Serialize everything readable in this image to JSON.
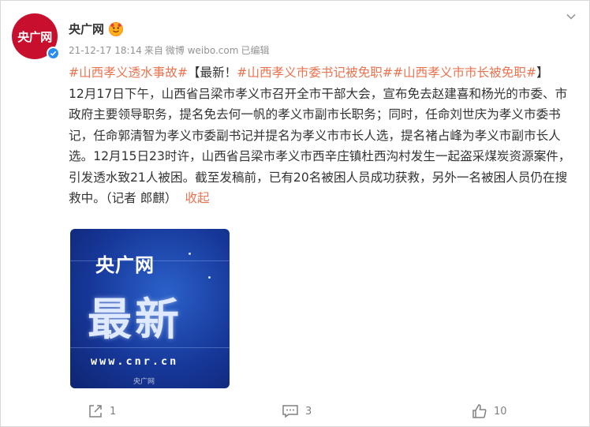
{
  "post": {
    "avatar_logo": "央广网",
    "user_name": "央广网",
    "time": "21-12-17 18:14",
    "source_prefix": "来自",
    "source": "微博 weibo.com",
    "edited": "已编辑",
    "text": {
      "tag1": "#山西孝义透水事故#",
      "bracket_open": "【最新！",
      "tag2": "#山西孝义市委书记被免职#",
      "tag3": "#山西孝义市市长被免职#",
      "bracket_close": "】",
      "body": "12月17日下午，山西省吕梁市孝义市召开全市干部大会，宣布免去赵建喜和杨光的市委、市政府主要领导职务，提名免去何一帆的孝义市副市长职务；同时，任命刘世庆为孝义市委书记，任命郭清智为孝义市委副书记并提名为孝义市市长人选，提名褚占峰为孝义市副市长人选。12月15日23时许，山西省吕梁市孝义市西辛庄镇杜西沟村发生一起盗采煤炭资源案件，引发透水致21人被困。截至发稿前，已有20名被困人员成功获救，另外一名被困人员仍在搜救中。（记者 郎麒）",
      "collapse": "收起"
    },
    "image": {
      "logo": "央广网",
      "big_text": "最新",
      "url": "www.cnr.cn",
      "watermark": "央广网"
    },
    "actions": {
      "repost_count": "1",
      "comment_count": "3",
      "like_count": "10"
    }
  },
  "colors": {
    "link": "#eb7350",
    "avatar_bg": "#c8102e",
    "verified": "#2a8cf0",
    "meta": "#939393"
  },
  "icons": [
    "verified-icon",
    "vip-badge-icon",
    "chevron-down-icon",
    "repost-icon",
    "comment-icon",
    "like-icon"
  ]
}
